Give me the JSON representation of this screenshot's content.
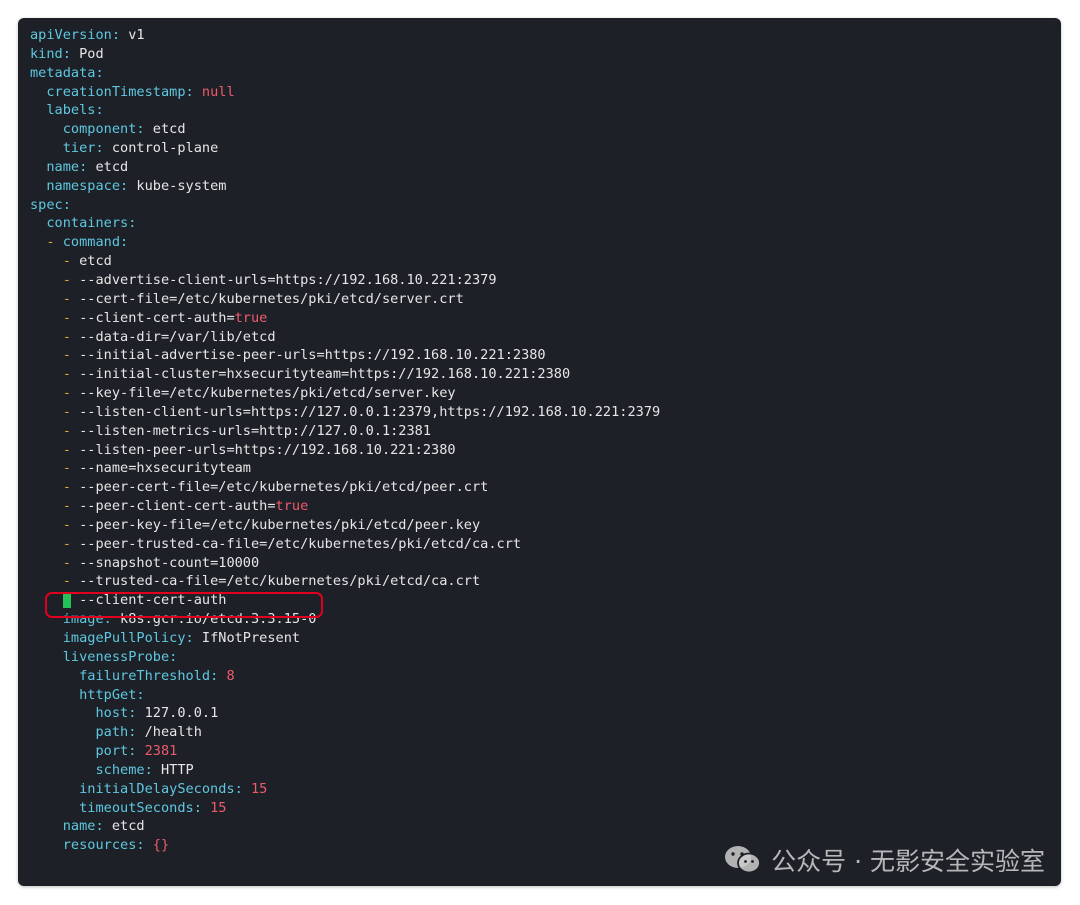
{
  "lines": [
    {
      "indent": "",
      "dash": "",
      "key": "apiVersion",
      "value": "v1",
      "vtype": "str"
    },
    {
      "indent": "",
      "dash": "",
      "key": "kind",
      "value": "Pod",
      "vtype": "str"
    },
    {
      "indent": "",
      "dash": "",
      "key": "metadata",
      "value": "",
      "vtype": "str"
    },
    {
      "indent": "  ",
      "dash": "",
      "key": "creationTimestamp",
      "value": "null",
      "vtype": "lit"
    },
    {
      "indent": "  ",
      "dash": "",
      "key": "labels",
      "value": "",
      "vtype": "str"
    },
    {
      "indent": "    ",
      "dash": "",
      "key": "component",
      "value": "etcd",
      "vtype": "str"
    },
    {
      "indent": "    ",
      "dash": "",
      "key": "tier",
      "value": "control-plane",
      "vtype": "str"
    },
    {
      "indent": "  ",
      "dash": "",
      "key": "name",
      "value": "etcd",
      "vtype": "str"
    },
    {
      "indent": "  ",
      "dash": "",
      "key": "namespace",
      "value": "kube-system",
      "vtype": "str"
    },
    {
      "indent": "",
      "dash": "",
      "key": "spec",
      "value": "",
      "vtype": "str"
    },
    {
      "indent": "  ",
      "dash": "",
      "key": "containers",
      "value": "",
      "vtype": "str"
    },
    {
      "indent": "  ",
      "dash": "- ",
      "key": "command",
      "value": "",
      "vtype": "str"
    },
    {
      "indent": "    ",
      "dash": "- ",
      "key": "",
      "value": "etcd",
      "vtype": "str"
    },
    {
      "indent": "    ",
      "dash": "- ",
      "key": "",
      "value": "--advertise-client-urls=https://192.168.10.221:2379",
      "vtype": "str"
    },
    {
      "indent": "    ",
      "dash": "- ",
      "key": "",
      "value": "--cert-file=/etc/kubernetes/pki/etcd/server.crt",
      "vtype": "str"
    },
    {
      "indent": "    ",
      "dash": "- ",
      "key": "",
      "value": "--client-cert-auth=",
      "vtype": "str",
      "suffix": "true"
    },
    {
      "indent": "    ",
      "dash": "- ",
      "key": "",
      "value": "--data-dir=/var/lib/etcd",
      "vtype": "str"
    },
    {
      "indent": "    ",
      "dash": "- ",
      "key": "",
      "value": "--initial-advertise-peer-urls=https://192.168.10.221:2380",
      "vtype": "str"
    },
    {
      "indent": "    ",
      "dash": "- ",
      "key": "",
      "value": "--initial-cluster=hxsecurityteam=https://192.168.10.221:2380",
      "vtype": "str"
    },
    {
      "indent": "    ",
      "dash": "- ",
      "key": "",
      "value": "--key-file=/etc/kubernetes/pki/etcd/server.key",
      "vtype": "str"
    },
    {
      "indent": "    ",
      "dash": "- ",
      "key": "",
      "value": "--listen-client-urls=https://127.0.0.1:2379,https://192.168.10.221:2379",
      "vtype": "str"
    },
    {
      "indent": "    ",
      "dash": "- ",
      "key": "",
      "value": "--listen-metrics-urls=http://127.0.0.1:2381",
      "vtype": "str"
    },
    {
      "indent": "    ",
      "dash": "- ",
      "key": "",
      "value": "--listen-peer-urls=https://192.168.10.221:2380",
      "vtype": "str"
    },
    {
      "indent": "    ",
      "dash": "- ",
      "key": "",
      "value": "--name=hxsecurityteam",
      "vtype": "str"
    },
    {
      "indent": "    ",
      "dash": "- ",
      "key": "",
      "value": "--peer-cert-file=/etc/kubernetes/pki/etcd/peer.crt",
      "vtype": "str"
    },
    {
      "indent": "    ",
      "dash": "- ",
      "key": "",
      "value": "--peer-client-cert-auth=",
      "vtype": "str",
      "suffix": "true"
    },
    {
      "indent": "    ",
      "dash": "- ",
      "key": "",
      "value": "--peer-key-file=/etc/kubernetes/pki/etcd/peer.key",
      "vtype": "str"
    },
    {
      "indent": "    ",
      "dash": "- ",
      "key": "",
      "value": "--peer-trusted-ca-file=/etc/kubernetes/pki/etcd/ca.crt",
      "vtype": "str"
    },
    {
      "indent": "    ",
      "dash": "- ",
      "key": "",
      "value": "--snapshot-count=10000",
      "vtype": "str"
    },
    {
      "indent": "    ",
      "dash": "- ",
      "key": "",
      "value": "--trusted-ca-file=/etc/kubernetes/pki/etcd/ca.crt",
      "vtype": "str"
    },
    {
      "indent": "    ",
      "dash": "- ",
      "key": "",
      "value": "--client-cert-auth",
      "vtype": "str",
      "cursor": true
    },
    {
      "indent": "    ",
      "dash": "",
      "key": "image",
      "value": "k8s.gcr.io/etcd:3.3.15-0",
      "vtype": "str"
    },
    {
      "indent": "    ",
      "dash": "",
      "key": "imagePullPolicy",
      "value": "IfNotPresent",
      "vtype": "str"
    },
    {
      "indent": "    ",
      "dash": "",
      "key": "livenessProbe",
      "value": "",
      "vtype": "str"
    },
    {
      "indent": "      ",
      "dash": "",
      "key": "failureThreshold",
      "value": "8",
      "vtype": "lit"
    },
    {
      "indent": "      ",
      "dash": "",
      "key": "httpGet",
      "value": "",
      "vtype": "str"
    },
    {
      "indent": "        ",
      "dash": "",
      "key": "host",
      "value": "127.0.0.1",
      "vtype": "str"
    },
    {
      "indent": "        ",
      "dash": "",
      "key": "path",
      "value": "/health",
      "vtype": "str"
    },
    {
      "indent": "        ",
      "dash": "",
      "key": "port",
      "value": "2381",
      "vtype": "lit"
    },
    {
      "indent": "        ",
      "dash": "",
      "key": "scheme",
      "value": "HTTP",
      "vtype": "str"
    },
    {
      "indent": "      ",
      "dash": "",
      "key": "initialDelaySeconds",
      "value": "15",
      "vtype": "lit"
    },
    {
      "indent": "      ",
      "dash": "",
      "key": "timeoutSeconds",
      "value": "15",
      "vtype": "lit"
    },
    {
      "indent": "    ",
      "dash": "",
      "key": "name",
      "value": "etcd",
      "vtype": "str"
    },
    {
      "indent": "    ",
      "dash": "",
      "key": "resources",
      "value": "{}",
      "vtype": "lit"
    }
  ],
  "watermark": {
    "text": "公众号 · 无影安全实验室",
    "icon": "wechat-icon"
  },
  "colors": {
    "background": "#1d2027",
    "key": "#5ec8e0",
    "dash": "#d9a441",
    "literal": "#ef5b6b",
    "text": "#e6e6e6",
    "cursor": "#23c35a",
    "highlight_box": "#e0001e"
  }
}
